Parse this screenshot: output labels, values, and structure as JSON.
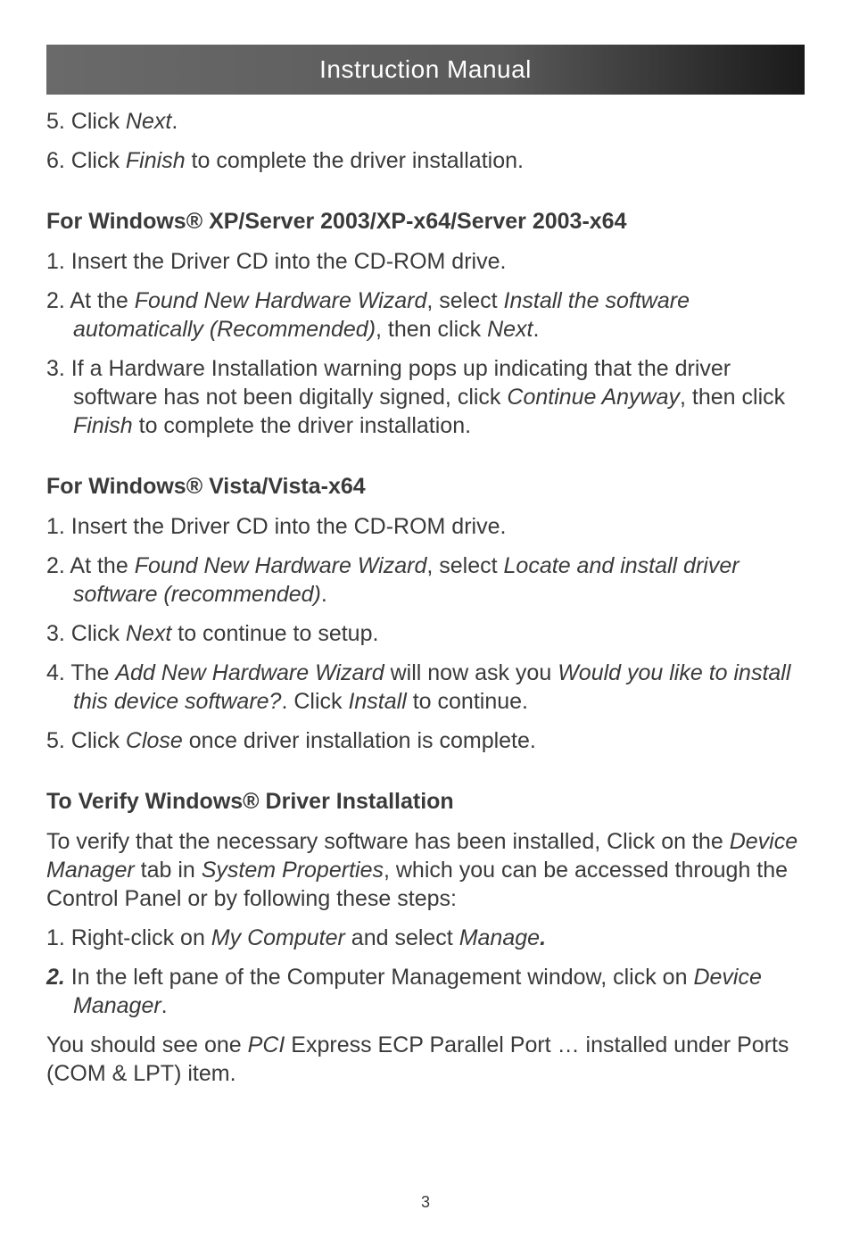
{
  "header": {
    "title": "Instruction Manual"
  },
  "top_steps": {
    "s5_prefix": "5. Click ",
    "s5_italic": "Next",
    "s5_suffix": ".",
    "s6_prefix": "6. Click ",
    "s6_italic": "Finish",
    "s6_suffix": " to complete the driver installation."
  },
  "section_xp": {
    "heading": "For Windows® XP/Server 2003/XP-x64/Server 2003-x64",
    "s1": "1. Insert the Driver CD into the CD-ROM drive.",
    "s2_a": "2. At the ",
    "s2_b": "Found New Hardware Wizard",
    "s2_c": ", select ",
    "s2_d": "Install the software automatically (Recommended)",
    "s2_e": ", then click ",
    "s2_f": "Next",
    "s2_g": ".",
    "s3_a": "3. If a Hardware Installation warning pops up indicating that the driver software has not been digitally signed, click ",
    "s3_b": "Continue Anyway",
    "s3_c": ", then click ",
    "s3_d": "Finish",
    "s3_e": " to complete the driver installation."
  },
  "section_vista": {
    "heading": "For Windows® Vista/Vista-x64",
    "s1": "1. Insert the Driver CD into the CD-ROM drive.",
    "s2_a": "2. At the ",
    "s2_b": "Found New Hardware Wizard",
    "s2_c": ", select ",
    "s2_d": "Locate and install driver software (recommended)",
    "s2_e": ".",
    "s3_a": "3. Click ",
    "s3_b": "Next",
    "s3_c": " to continue to setup.",
    "s4_a": "4. The ",
    "s4_b": "Add New Hardware Wizard",
    "s4_c": " will now ask you ",
    "s4_d": "Would you like to install this device software?",
    "s4_e": ". Click ",
    "s4_f": "Install",
    "s4_g": " to continue.",
    "s5_a": "5. Click ",
    "s5_b": "Close",
    "s5_c": " once driver installation is complete."
  },
  "section_verify": {
    "heading": "To Verify Windows® Driver Installation",
    "p1_a": "To verify that the necessary software has been installed, Click on the ",
    "p1_b": "Device Manager",
    "p1_c": " tab in ",
    "p1_d": "System Properties",
    "p1_e": ", which you can be accessed through the Control Panel or by following these steps:",
    "s1_a": "1.  Right-click on ",
    "s1_b": "My Computer",
    "s1_c": " and select ",
    "s1_d": "Manage",
    "s1_e": ".",
    "s2_a": "2.",
    "s2_b": "  In the left pane of the Computer Management window, click on ",
    "s2_c": "Device Manager",
    "s2_d": ".",
    "p2_a": "You should see one ",
    "p2_b": "PCI",
    "p2_c": " Express ECP Parallel Port … installed under Ports (COM & LPT) item."
  },
  "page_number": "3"
}
